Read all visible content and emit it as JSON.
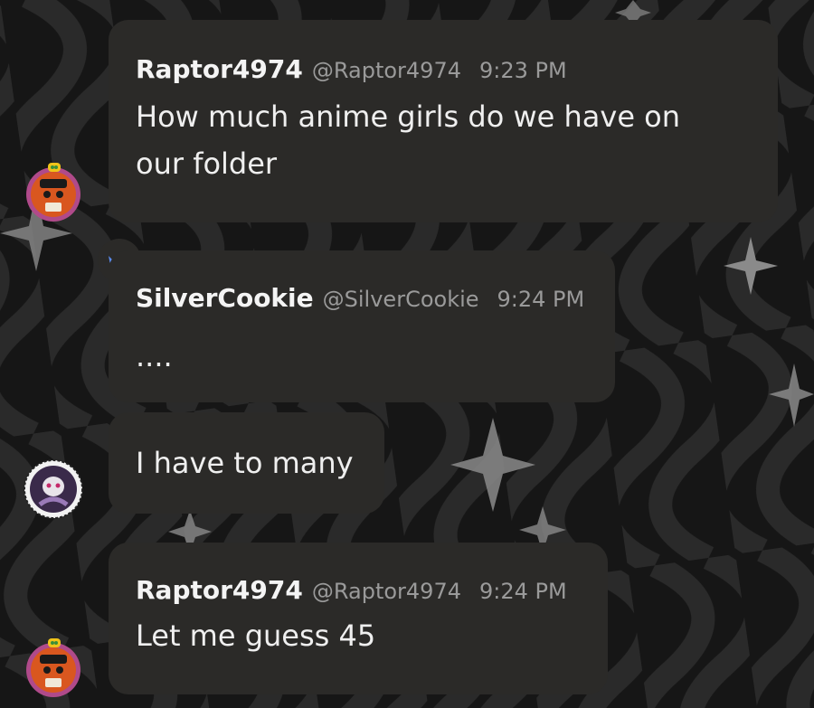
{
  "messages": [
    {
      "name": "Raptor4974",
      "handle": "@Raptor4974",
      "time": "9:23 PM",
      "text_line1": "How much anime girls do we have on",
      "text_line2": "our folder"
    },
    {
      "name": "SilverCookie",
      "handle": "@SilverCookie",
      "time": "9:24 PM",
      "text": "...."
    },
    {
      "text": "I have to many"
    },
    {
      "name": "Raptor4974",
      "handle": "@Raptor4974",
      "time": "9:24 PM",
      "text": "Let me guess 45"
    }
  ],
  "colors": {
    "background": "#141414",
    "bubble": "#2b2a28",
    "crown": "#5b8cf0",
    "raptor_avatar_ring": "#b04a8a",
    "raptor_avatar_face": "#d9571f"
  },
  "icons": [
    "sparkle-icon",
    "crown-icon"
  ]
}
